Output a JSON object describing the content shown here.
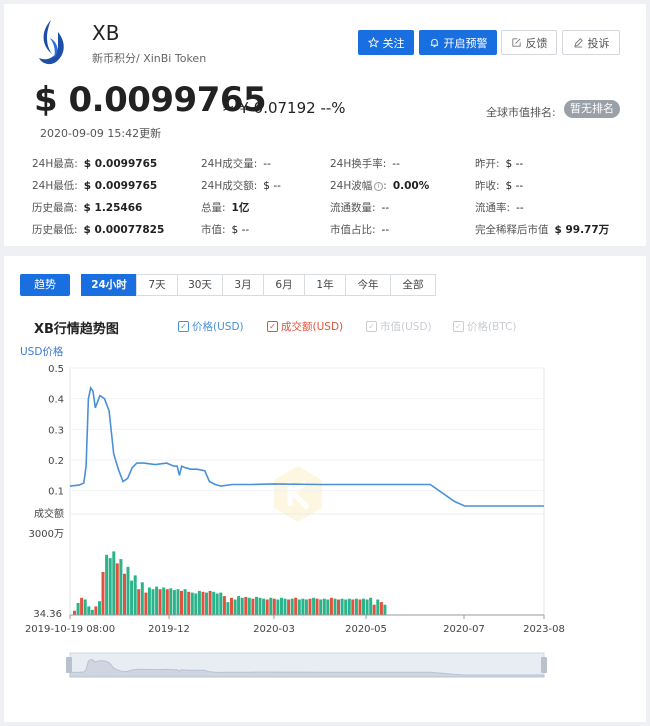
{
  "coin": {
    "symbol": "XB",
    "subtitle": "新币积分/ XinBi Token"
  },
  "actions": {
    "follow": "关注",
    "alert": "开启预警",
    "feedback": "反馈",
    "complaint": "投诉"
  },
  "price": {
    "usd": "$ 0.0099765",
    "cny": "≈ ¥ 0.07192  --%",
    "updated": "2020-09-09 15:42更新",
    "rank_label": "全球市值排名:",
    "rank_value": "暂无排名"
  },
  "stats": {
    "high24": {
      "label": "24H最高:",
      "value": "$ 0.0099765"
    },
    "low24": {
      "label": "24H最低:",
      "value": "$ 0.0099765"
    },
    "ath": {
      "label": "历史最高:",
      "value": "$ 1.25466"
    },
    "atl": {
      "label": "历史最低:",
      "value": "$ 0.00077825"
    },
    "vol24": {
      "label": "24H成交量:",
      "value": "--"
    },
    "amount24": {
      "label": "24H成交额:",
      "value": "$ --"
    },
    "total_supply": {
      "label": "总量:",
      "value": "1亿"
    },
    "market_cap": {
      "label": "市值:",
      "value": "$ --"
    },
    "turnover24": {
      "label": "24H换手率:",
      "value": "--"
    },
    "volatility24": {
      "label": "24H波幅",
      "value": "0.00%"
    },
    "circulating": {
      "label": "流通数量:",
      "value": "--"
    },
    "cap_share": {
      "label": "市值占比:",
      "value": "--"
    },
    "open": {
      "label": "昨开:",
      "value": "$ --"
    },
    "close": {
      "label": "昨收:",
      "value": "$ --"
    },
    "circ_rate": {
      "label": "流通率:",
      "value": "--"
    },
    "fdv": {
      "label": "完全稀释后市值",
      "value": "$ 99.77万"
    }
  },
  "tabs": {
    "trend": "趋势",
    "ranges": [
      "24小时",
      "7天",
      "30天",
      "3月",
      "6月",
      "1年",
      "今年",
      "全部"
    ],
    "active_range": "24小时"
  },
  "legend": [
    {
      "label": "价格(USD)",
      "color": "#4a90d9",
      "checked": true
    },
    {
      "label": "成交额(USD)",
      "color": "#e0533e",
      "checked": true
    },
    {
      "label": "市值(USD)",
      "color": "#c8ccd2",
      "checked": true
    },
    {
      "label": "价格(BTC)",
      "color": "#c8ccd2",
      "checked": true
    }
  ],
  "colors": {
    "accent": "#1a6fe0",
    "price_line": "#4a90d9",
    "vol_red": "#e0533e",
    "vol_green": "#2bb48c"
  },
  "chart_data": {
    "type": "line",
    "title": "XB行情趋势图",
    "ylabel": "USD价格",
    "vol_label": "成交额",
    "y_ticks": [
      "0.1",
      "0.2",
      "0.3",
      "0.4",
      "0.5"
    ],
    "ylim": [
      0.05,
      0.5
    ],
    "vol_ticks": [
      "34.36",
      "3000万"
    ],
    "x_ticks": [
      "2019-10-19 08:00",
      "2019-12",
      "2020-03",
      "2020-05",
      "2020-07",
      "2023-08"
    ],
    "price": {
      "name": "价格(USD)",
      "x": [
        "2019-10-19",
        "2019-10-23",
        "2019-10-25",
        "2019-10-26",
        "2019-10-27",
        "2019-10-28",
        "2019-10-29",
        "2019-10-30",
        "2019-10-31",
        "2019-11-01",
        "2019-11-03",
        "2019-11-05",
        "2019-11-07",
        "2019-11-09",
        "2019-11-11",
        "2019-11-13",
        "2019-11-15",
        "2019-11-17",
        "2019-11-20",
        "2019-11-25",
        "2019-11-30",
        "2019-12-05",
        "2019-12-08",
        "2019-12-10",
        "2019-12-12",
        "2019-12-15",
        "2019-12-20",
        "2019-12-25",
        "2020-01-01",
        "2020-01-05",
        "2020-01-10",
        "2020-01-15",
        "2020-01-25",
        "2020-02-10",
        "2020-03-01",
        "2020-04-01",
        "2020-05-01",
        "2020-06-01",
        "2020-06-10",
        "2020-06-25",
        "2020-07-10",
        "2023-08-01"
      ],
      "y": [
        0.115,
        0.118,
        0.125,
        0.18,
        0.4,
        0.435,
        0.425,
        0.37,
        0.39,
        0.41,
        0.4,
        0.36,
        0.22,
        0.17,
        0.13,
        0.14,
        0.175,
        0.19,
        0.19,
        0.185,
        0.19,
        0.18,
        0.18,
        0.15,
        0.18,
        0.175,
        0.17,
        0.17,
        0.165,
        0.13,
        0.12,
        0.115,
        0.12,
        0.12,
        0.122,
        0.12,
        0.12,
        0.12,
        0.12,
        0.065,
        0.05,
        0.05
      ]
    },
    "volume_relative": [
      0.05,
      0.14,
      0.2,
      0.18,
      0.1,
      0.06,
      0.1,
      0.16,
      0.5,
      0.7,
      0.66,
      0.74,
      0.6,
      0.65,
      0.48,
      0.56,
      0.4,
      0.46,
      0.3,
      0.38,
      0.26,
      0.32,
      0.3,
      0.33,
      0.3,
      0.32,
      0.3,
      0.31,
      0.29,
      0.3,
      0.28,
      0.3,
      0.27,
      0.26,
      0.25,
      0.28,
      0.27,
      0.26,
      0.28,
      0.27,
      0.25,
      0.26,
      0.22,
      0.15,
      0.2,
      0.18,
      0.22,
      0.2,
      0.21,
      0.2,
      0.19,
      0.21,
      0.2,
      0.19,
      0.18,
      0.2,
      0.19,
      0.18,
      0.2,
      0.19,
      0.18,
      0.19,
      0.2,
      0.18,
      0.19,
      0.18,
      0.19,
      0.2,
      0.19,
      0.18,
      0.19,
      0.18,
      0.2,
      0.19,
      0.18,
      0.19,
      0.18,
      0.19,
      0.18,
      0.19,
      0.18,
      0.19,
      0.18,
      0.2,
      0.12,
      0.18,
      0.15,
      0.12
    ]
  }
}
